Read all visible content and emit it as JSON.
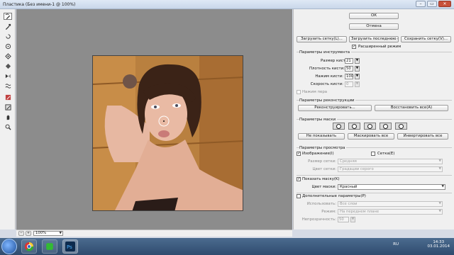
{
  "window": {
    "title": "Пластика (Без имени-1 @ 100%)",
    "min": "–",
    "max": "▭",
    "close": "✕"
  },
  "tools": [
    "warp-tool",
    "reconstruct-tool",
    "twirl-tool",
    "pucker-tool",
    "bloat-tool",
    "push-left-tool",
    "mirror-tool",
    "turbulence-tool",
    "freeze-mask-tool",
    "thaw-mask-tool",
    "hand-tool",
    "zoom-tool"
  ],
  "buttons": {
    "ok": "ОК",
    "cancel": "Отмена",
    "load_mesh": "Загрузить сетку(L)...",
    "load_last_mesh": "Загрузить последнюю сетку",
    "save_mesh": "Сохранить сетку(V)..."
  },
  "advanced_mode": "Расширенный режим",
  "tool_options": {
    "header": "Параметры инструмента",
    "brush_size_label": "Размер кисти:",
    "brush_size": "21",
    "brush_density_label": "Плотность кисти:",
    "brush_density": "50",
    "brush_pressure_label": "Нажим кисти:",
    "brush_pressure": "100",
    "brush_rate_label": "Скорость кисти:",
    "brush_rate": "0",
    "stylus_pressure": "Нажим пера"
  },
  "reconstruct": {
    "header": "Параметры реконструкции",
    "reconstruct_btn": "Реконструировать...",
    "restore_all_btn": "Восстановить все(A)"
  },
  "mask": {
    "header": "Параметры маски",
    "none_btn": "Не показывать",
    "mask_all_btn": "Маскировать все",
    "invert_all_btn": "Инвертировать все"
  },
  "view": {
    "header": "Параметры просмотра",
    "show_image": "Изображение(I)",
    "show_mesh": "Сетка(E)",
    "mesh_size_label": "Размер сетки:",
    "mesh_size": "Средняя",
    "mesh_color_label": "Цвет сетки:",
    "mesh_color": "Градации серого",
    "show_mask": "Показать маску(K)",
    "mask_color_label": "Цвет маски:",
    "mask_color": "Красный",
    "show_backdrop": "Дополнительные параметры(P)",
    "use_label": "Использовать:",
    "use_value": "Все слои",
    "mode_label": "Режим:",
    "mode_value": "На переднем плане",
    "opacity_label": "Непрозрачность:",
    "opacity_value": "50"
  },
  "status": {
    "zoom": "100%"
  },
  "taskbar": {
    "lang": "RU",
    "time": "14:33",
    "date": "03.01.2014"
  },
  "colors": {
    "canvas_bg": "#8c8c8c",
    "panel_bg": "#f0f0f0"
  }
}
